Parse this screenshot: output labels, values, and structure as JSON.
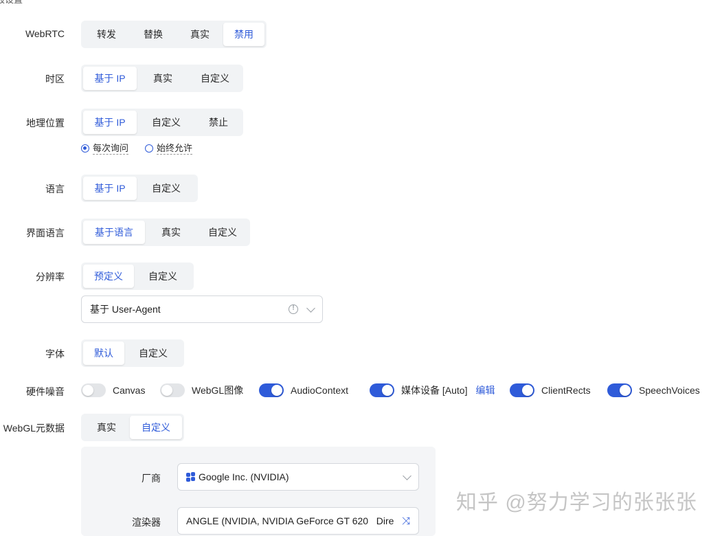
{
  "section_title": "殴设置",
  "rows": {
    "webrtc": {
      "label": "WebRTC",
      "options": [
        "转发",
        "替换",
        "真实",
        "禁用"
      ],
      "selected": 3
    },
    "timezone": {
      "label": "时区",
      "options": [
        "基于 IP",
        "真实",
        "自定义"
      ],
      "selected": 0
    },
    "geolocation": {
      "label": "地理位置",
      "options": [
        "基于 IP",
        "自定义",
        "禁止"
      ],
      "selected": 0,
      "radios": [
        {
          "label": "每次询问",
          "checked": true
        },
        {
          "label": "始终允许",
          "checked": false
        }
      ]
    },
    "language": {
      "label": "语言",
      "options": [
        "基于 IP",
        "自定义"
      ],
      "selected": 0
    },
    "ui_language": {
      "label": "界面语言",
      "options": [
        "基于语言",
        "真实",
        "自定义"
      ],
      "selected": 0
    },
    "resolution": {
      "label": "分辨率",
      "options": [
        "预定义",
        "自定义"
      ],
      "selected": 0,
      "select_value": "基于 User-Agent"
    },
    "fonts": {
      "label": "字体",
      "options": [
        "默认",
        "自定义"
      ],
      "selected": 0
    },
    "hardware_noise": {
      "label": "硬件噪音",
      "toggles": [
        {
          "label": "Canvas",
          "on": false
        },
        {
          "label": "WebGL图像",
          "on": false
        },
        {
          "label": "AudioContext",
          "on": true
        },
        {
          "label": "媒体设备 [Auto]",
          "on": true,
          "link": "编辑"
        },
        {
          "label": "ClientRects",
          "on": true
        },
        {
          "label": "SpeechVoices",
          "on": true
        }
      ]
    },
    "webgl_meta": {
      "label": "WebGL元数据",
      "options": [
        "真实",
        "自定义"
      ],
      "selected": 1,
      "vendor_label": "厂商",
      "vendor_value": "Google Inc. (NVIDIA)",
      "renderer_label": "渲染器",
      "renderer_value": "ANGLE (NVIDIA, NVIDIA GeForce GT 620   Dire"
    }
  },
  "watermark": "知乎 @努力学习的张张张",
  "colors": {
    "accent": "#2f5bd9",
    "segment_bg": "#f1f3f5",
    "panel_bg": "#f4f5f7"
  }
}
